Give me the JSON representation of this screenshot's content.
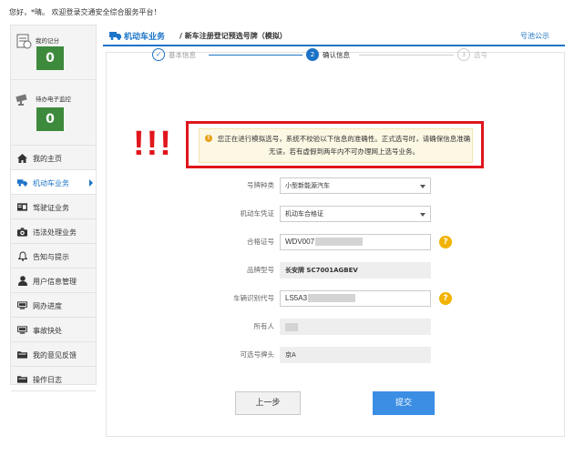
{
  "header": {
    "welcome": "您好，*晴。 欢迎登录交通安全综合服务平台！"
  },
  "sidebar": {
    "stats": [
      {
        "label": "我的记分",
        "value": "0",
        "icon": "score-sheet-icon"
      },
      {
        "label": "待办电子监控",
        "value": "0",
        "icon": "camera-icon"
      }
    ],
    "items": [
      {
        "label": "我的主页",
        "icon": "home-icon"
      },
      {
        "label": "机动车业务",
        "icon": "truck-icon",
        "active": true
      },
      {
        "label": "驾驶证业务",
        "icon": "license-card-icon"
      },
      {
        "label": "违法处理业务",
        "icon": "camera-icon"
      },
      {
        "label": "告知与提示",
        "icon": "bell-icon"
      },
      {
        "label": "用户信息管理",
        "icon": "user-icon"
      },
      {
        "label": "网办进度",
        "icon": "monitor-icon"
      },
      {
        "label": "事故快处",
        "icon": "monitor-icon"
      },
      {
        "label": "我的意见反馈",
        "icon": "folder-icon"
      },
      {
        "label": "操作日志",
        "icon": "folder-icon"
      }
    ]
  },
  "topbar": {
    "section": "机动车业务",
    "title": "/ 新车注册登记预选号牌（模拟）",
    "link": "号池公示"
  },
  "steps": [
    {
      "number": "1",
      "label": "基本信息",
      "state": "done"
    },
    {
      "number": "2",
      "label": "确认信息",
      "state": "active"
    },
    {
      "number": "3",
      "label": "选号",
      "state": "pending"
    }
  ],
  "annotation": {
    "marks": "!!!"
  },
  "notice": {
    "text": "您正在进行模拟选号，系统不校验以下信息的准确性。正式选号时，请确保信息准确无误，若有虚假到两年内不可办理网上选号业务。"
  },
  "form": {
    "plate_type": {
      "label": "号牌种类",
      "value": "小型新能源汽车"
    },
    "certificate": {
      "label": "机动车凭证",
      "value": "机动车合格证"
    },
    "cert_no": {
      "label": "合格证号",
      "value": "WDV007"
    },
    "model": {
      "label": "品牌型号",
      "value": "长安牌 SC7001AGBEV"
    },
    "vin": {
      "label": "车辆识别代号",
      "value": "LS5A3"
    },
    "owner": {
      "label": "所有人",
      "value": ""
    },
    "plate_prefix": {
      "label": "可选号牌头",
      "value": "京A"
    }
  },
  "buttons": {
    "back": "上一步",
    "submit": "提交"
  },
  "colors": {
    "accent": "#1c74c7",
    "badge": "#3d8a3d",
    "alert": "#e0161d",
    "submit": "#3b8ee3",
    "help": "#f2b300"
  }
}
